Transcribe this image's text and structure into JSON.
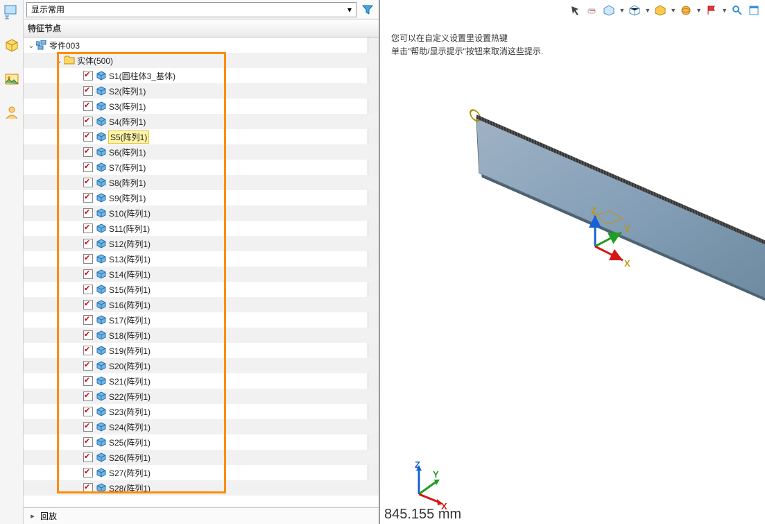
{
  "sidebar": {
    "dropdown_label": "显示常用",
    "panel_title": "特征节点",
    "root_label": "零件003",
    "folder_label": "实体(500)",
    "items": [
      {
        "label": "S1(圆柱体3_基体)"
      },
      {
        "label": "S2(阵列1)"
      },
      {
        "label": "S3(阵列1)"
      },
      {
        "label": "S4(阵列1)"
      },
      {
        "label": "S5(阵列1)",
        "selected": true
      },
      {
        "label": "S6(阵列1)"
      },
      {
        "label": "S7(阵列1)"
      },
      {
        "label": "S8(阵列1)"
      },
      {
        "label": "S9(阵列1)"
      },
      {
        "label": "S10(阵列1)"
      },
      {
        "label": "S11(阵列1)"
      },
      {
        "label": "S12(阵列1)"
      },
      {
        "label": "S13(阵列1)"
      },
      {
        "label": "S14(阵列1)"
      },
      {
        "label": "S15(阵列1)"
      },
      {
        "label": "S16(阵列1)"
      },
      {
        "label": "S17(阵列1)"
      },
      {
        "label": "S18(阵列1)"
      },
      {
        "label": "S19(阵列1)"
      },
      {
        "label": "S20(阵列1)"
      },
      {
        "label": "S21(阵列1)"
      },
      {
        "label": "S22(阵列1)"
      },
      {
        "label": "S23(阵列1)"
      },
      {
        "label": "S24(阵列1)"
      },
      {
        "label": "S25(阵列1)"
      },
      {
        "label": "S26(阵列1)"
      },
      {
        "label": "S27(阵列1)"
      },
      {
        "label": "S28(阵列1)"
      }
    ],
    "footer_label": "回放"
  },
  "viewport": {
    "tip_line1": "您可以在自定义设置里设置热键",
    "tip_line2": "单击\"帮助/显示提示\"按钮来取消这些提示.",
    "dimension": "845.155 mm",
    "axes": {
      "x": "X",
      "y": "Y",
      "z": "Z"
    }
  }
}
